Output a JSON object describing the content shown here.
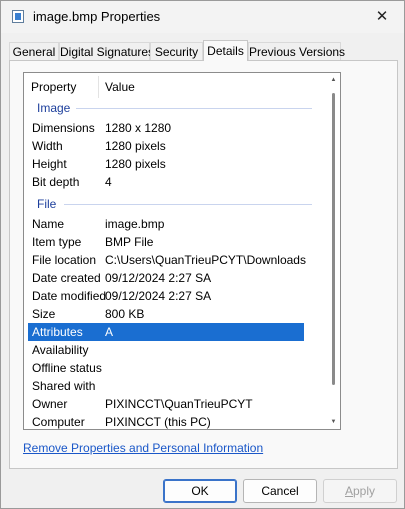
{
  "window": {
    "title": "image.bmp Properties",
    "close_glyph": "✕",
    "icon": "bitmap-file-icon"
  },
  "tabs": [
    {
      "label": "General",
      "active": false
    },
    {
      "label": "Digital Signatures",
      "active": false
    },
    {
      "label": "Security",
      "active": false
    },
    {
      "label": "Details",
      "active": true
    },
    {
      "label": "Previous Versions",
      "active": false
    }
  ],
  "list": {
    "header": {
      "property": "Property",
      "value": "Value"
    },
    "groups": {
      "image": "Image",
      "file": "File"
    },
    "image_rows": [
      {
        "name": "Dimensions",
        "value": "1280 x 1280"
      },
      {
        "name": "Width",
        "value": "1280 pixels"
      },
      {
        "name": "Height",
        "value": "1280 pixels"
      },
      {
        "name": "Bit depth",
        "value": "4"
      }
    ],
    "file_rows": [
      {
        "name": "Name",
        "value": "image.bmp"
      },
      {
        "name": "Item type",
        "value": "BMP File"
      },
      {
        "name": "File location",
        "value": "C:\\Users\\QuanTrieuPCYT\\Downloads"
      },
      {
        "name": "Date created",
        "value": "09/12/2024 2:27 SA"
      },
      {
        "name": "Date modified",
        "value": "09/12/2024 2:27 SA"
      },
      {
        "name": "Size",
        "value": "800 KB"
      },
      {
        "name": "Attributes",
        "value": "A",
        "selected": true
      },
      {
        "name": "Availability",
        "value": ""
      },
      {
        "name": "Offline status",
        "value": ""
      },
      {
        "name": "Shared with",
        "value": ""
      },
      {
        "name": "Owner",
        "value": "PIXINCCT\\QuanTrieuPCYT"
      },
      {
        "name": "Computer",
        "value": "PIXINCCT (this PC)"
      }
    ]
  },
  "remove_link": "Remove Properties and Personal Information",
  "buttons": {
    "ok": "OK",
    "cancel": "Cancel",
    "apply_first": "A",
    "apply_rest": "pply"
  },
  "colors": {
    "selection": "#1a6ed1",
    "group_label": "#1d3f9c",
    "link": "#1a57c8"
  }
}
